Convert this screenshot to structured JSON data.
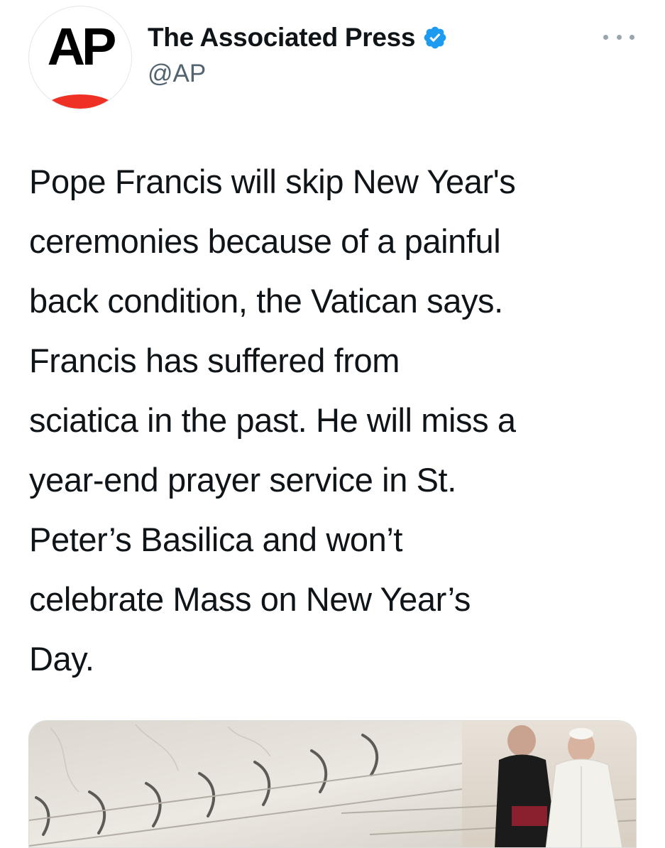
{
  "account": {
    "avatar_text": "AP",
    "display_name": "The Associated Press",
    "handle": "@AP",
    "verified": true
  },
  "colors": {
    "ap_red": "#ee3124",
    "verified_blue": "#1d9bf0",
    "muted": "#536471"
  },
  "tweet": {
    "lines": [
      "Pope Francis will skip New Year's",
      "ceremonies because of a painful",
      "back condition, the Vatican says.",
      "Francis has suffered from",
      "sciatica in the past. He will miss a",
      "year-end prayer service in St.",
      "Peter’s Basilica and won’t",
      "celebrate Mass on New Year’s",
      "Day."
    ]
  },
  "icons": {
    "verified": "verified-badge-icon",
    "more": "more-options-icon"
  },
  "media": {
    "type": "photo"
  }
}
